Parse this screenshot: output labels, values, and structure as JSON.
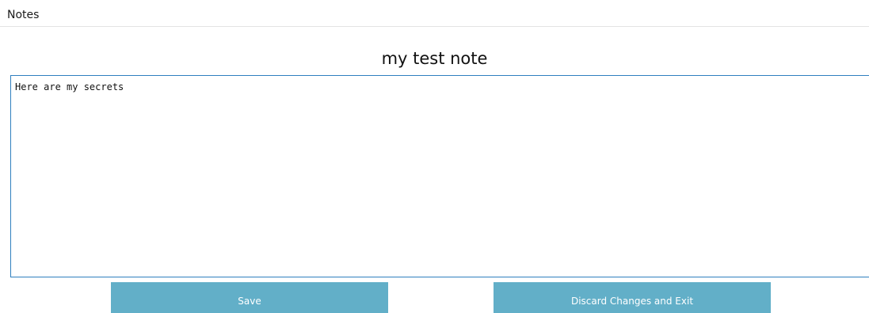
{
  "app": {
    "title": "Notes"
  },
  "note": {
    "title": "my test note",
    "body": "Here are my secrets"
  },
  "actions": {
    "save_label": "Save",
    "discard_label": "Discard Changes and Exit"
  },
  "colors": {
    "button_bg": "#62afc8",
    "editor_border": "#2f7fbf"
  }
}
